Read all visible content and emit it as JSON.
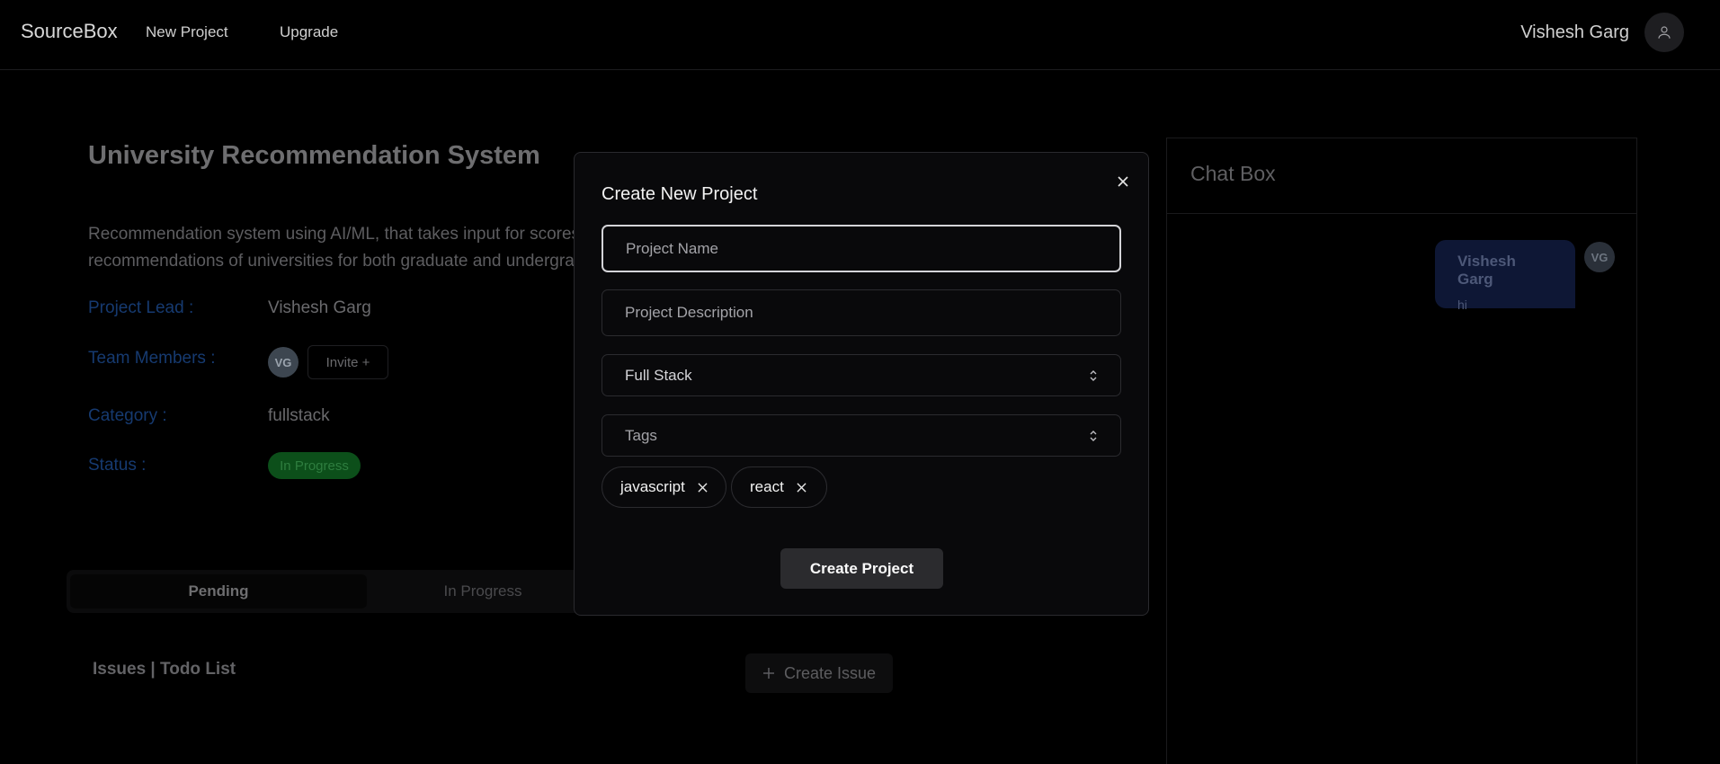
{
  "navbar": {
    "brand": "SourceBox",
    "links": [
      {
        "label": "New Project"
      },
      {
        "label": "Upgrade"
      }
    ],
    "user_name": "Vishesh Garg",
    "user_icon": "user-icon"
  },
  "project": {
    "title": "University Recommendation System",
    "description_lines": [
      "Recommendation system using AI/ML, that takes input for scores and gives",
      "recommendations of universities for both graduate and undergraduate"
    ],
    "lead_label": "Project Lead :",
    "lead_value": "Vishesh Garg",
    "team_label": "Team Members :",
    "team_avatar": "VG",
    "invite_label": "Invite +",
    "category_label": "Category :",
    "category_value": "fullstack",
    "status_label": "Status :",
    "status_value": "In Progress",
    "status_color": "#0c4f1a"
  },
  "tabs": [
    {
      "label": "Pending",
      "active": true
    },
    {
      "label": "In Progress",
      "active": false
    }
  ],
  "issues": {
    "heading": "Issues | Todo List",
    "create_label": "Create Issue"
  },
  "chat": {
    "title": "Chat Box",
    "messages": [
      {
        "author": "Vishesh Garg",
        "text": "hi",
        "avatar": "VG"
      }
    ]
  },
  "modal": {
    "title": "Create New Project",
    "project_name_placeholder": "Project Name",
    "project_description_placeholder": "Project Description",
    "category_selected": "Full Stack",
    "tags_placeholder": "Tags",
    "tags": [
      "javascript",
      "react"
    ],
    "submit_label": "Create Project"
  }
}
